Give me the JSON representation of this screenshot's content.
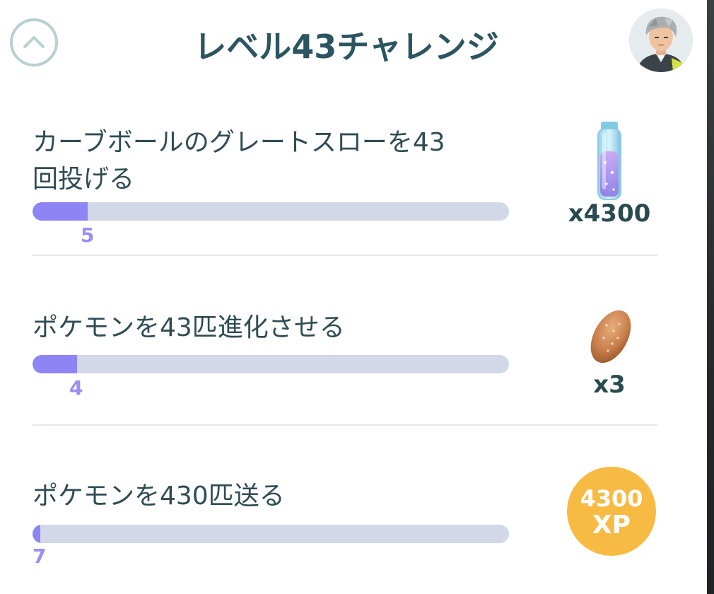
{
  "header": {
    "title": "レベル43チャレンジ",
    "collapse_icon": "chevron-up-icon",
    "avatar_icon": "trainer-avatar-icon"
  },
  "tasks": [
    {
      "text_line1": "カーブボールのグレートスローを43",
      "text_line2": "回投げる",
      "progress_value": "5",
      "progress_fraction": 0.116,
      "reward_icon": "stardust-vial-icon",
      "reward_count": "x4300"
    },
    {
      "text_line1": "ポケモンを43匹進化させる",
      "progress_value": "4",
      "progress_fraction": 0.093,
      "reward_icon": "nanab-berry-icon",
      "reward_count": "x3"
    },
    {
      "text_line1": "ポケモンを430匹送る",
      "progress_value": "7",
      "progress_fraction": 0.016,
      "reward_icon": "xp-badge-icon",
      "reward_xp_amount": "4300",
      "reward_xp_unit": "XP"
    }
  ],
  "colors": {
    "title": "#2b5560",
    "progress_fill": "#8e84f4",
    "progress_track": "#d3d8e8",
    "progress_label": "#9b8ef5",
    "xp_badge": "#f7bb44"
  }
}
